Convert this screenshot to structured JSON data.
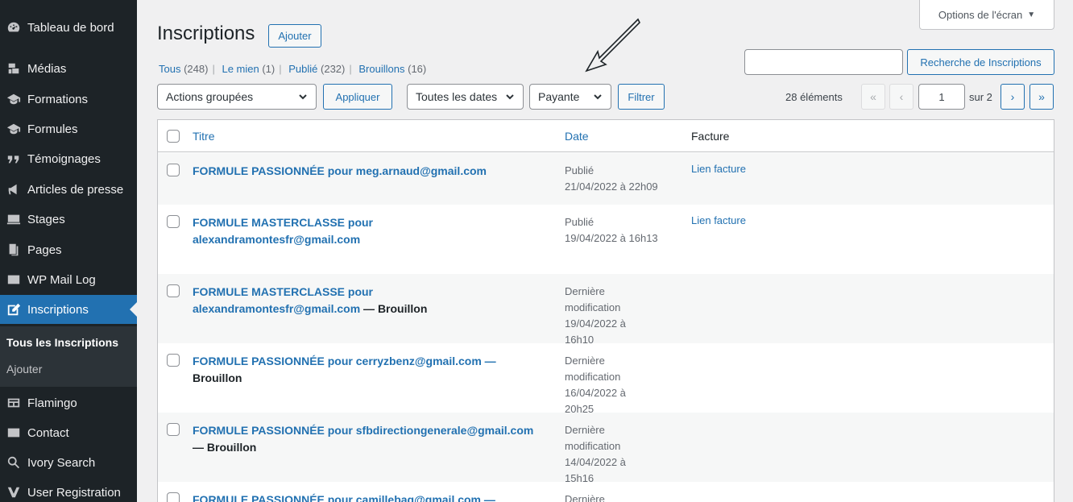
{
  "sidebar": {
    "items": [
      {
        "label": "Tableau de bord",
        "icon": "dashboard-icon"
      },
      {
        "label": "Médias",
        "icon": "media-icon"
      },
      {
        "label": "Formations",
        "icon": "graduation-cap-icon"
      },
      {
        "label": "Formules",
        "icon": "graduation-cap-icon"
      },
      {
        "label": "Témoignages",
        "icon": "quote-icon"
      },
      {
        "label": "Articles de presse",
        "icon": "megaphone-icon"
      },
      {
        "label": "Stages",
        "icon": "stages-icon"
      },
      {
        "label": "Pages",
        "icon": "pages-icon"
      },
      {
        "label": "WP Mail Log",
        "icon": "mail-icon"
      },
      {
        "label": "Inscriptions",
        "icon": "edit-icon"
      },
      {
        "label": "Flamingo",
        "icon": "flamingo-icon"
      },
      {
        "label": "Contact",
        "icon": "mail-icon"
      },
      {
        "label": "Ivory Search",
        "icon": "search-icon"
      },
      {
        "label": "User Registration",
        "icon": "user-registration-icon"
      }
    ],
    "submenu": {
      "current": "Tous les Inscriptions",
      "add": "Ajouter"
    }
  },
  "header": {
    "title": "Inscriptions",
    "add_button": "Ajouter",
    "screen_options": "Options de l'écran"
  },
  "filters": {
    "all": "Tous",
    "all_count": "(248)",
    "mine": "Le mien",
    "mine_count": "(1)",
    "published": "Publié",
    "published_count": "(232)",
    "drafts": "Brouillons",
    "drafts_count": "(16)",
    "bulk_actions": "Actions groupées",
    "apply": "Appliquer",
    "dates": "Toutes les dates",
    "type": "Payante",
    "filter": "Filtrer"
  },
  "search": {
    "button": "Recherche de Inscriptions",
    "value": ""
  },
  "pagination": {
    "count": "28 éléments",
    "first": "«",
    "prev": "‹",
    "current": "1",
    "total": "sur 2",
    "next": "›",
    "last": "»"
  },
  "table": {
    "columns": {
      "title": "Titre",
      "date": "Date",
      "invoice": "Facture"
    },
    "rows": [
      {
        "title": "FORMULE PASSIONNÉE pour meg.arnaud@gmail.com",
        "state": "",
        "date_status": "Publié",
        "date": "21/04/2022 à 22h09",
        "invoice": "Lien facture"
      },
      {
        "title": "FORMULE MASTERCLASSE pour alexandramontesfr@gmail.com",
        "state": "",
        "date_status": "Publié",
        "date": "19/04/2022 à 16h13",
        "invoice": "Lien facture"
      },
      {
        "title": "FORMULE MASTERCLASSE pour alexandramontesfr@gmail.com",
        "state": " — Brouillon",
        "date_status": "Dernière modification",
        "date": "19/04/2022 à 16h10",
        "invoice": ""
      },
      {
        "title": "FORMULE PASSIONNÉE pour cerryzbenz@gmail.com —",
        "state": "Brouillon",
        "date_status": "Dernière modification",
        "date": "16/04/2022 à 20h25",
        "invoice": ""
      },
      {
        "title": "FORMULE PASSIONNÉE pour sfbdirectiongenerale@gmail.com",
        "state": "— Brouillon",
        "date_status": "Dernière modification",
        "date": "14/04/2022 à 15h16",
        "invoice": ""
      },
      {
        "title": "FORMULE PASSIONNÉE pour camillebag@gmail.com —",
        "state": "",
        "date_status": "Dernière",
        "date": "",
        "invoice": ""
      }
    ]
  },
  "colors": {
    "sidebar_bg": "#1d2327",
    "active": "#2271b1",
    "link": "#2271b1"
  }
}
